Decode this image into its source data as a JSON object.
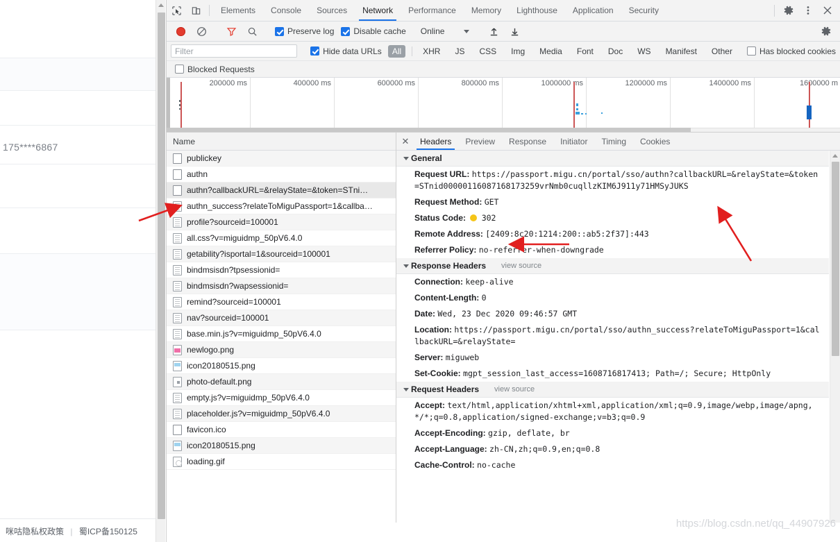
{
  "page": {
    "masked_phone": "175****6867",
    "footer": {
      "privacy_link": "咪咕隐私权政策",
      "separator": "|",
      "icp": "蜀ICP备150125"
    }
  },
  "devtools": {
    "main_tabs": [
      {
        "label": "Elements",
        "active": false
      },
      {
        "label": "Console",
        "active": false
      },
      {
        "label": "Sources",
        "active": false
      },
      {
        "label": "Network",
        "active": true
      },
      {
        "label": "Performance",
        "active": false
      },
      {
        "label": "Memory",
        "active": false
      },
      {
        "label": "Lighthouse",
        "active": false
      },
      {
        "label": "Application",
        "active": false
      },
      {
        "label": "Security",
        "active": false
      }
    ],
    "toolbar": {
      "record_title": "record-button",
      "clear_title": "clear-button",
      "filter_title": "filter-button",
      "search_title": "search-button",
      "preserve_log_label": "Preserve log",
      "preserve_log_checked": true,
      "disable_cache_label": "Disable cache",
      "disable_cache_checked": true,
      "throttle_value": "Online",
      "import_title": "import-har-button",
      "export_title": "export-har-button",
      "settings_title": "network-settings-button"
    },
    "filterbar": {
      "filter_placeholder": "Filter",
      "filter_value": "",
      "hide_data_urls_label": "Hide data URLs",
      "hide_data_urls_checked": true,
      "resource_types": [
        "All",
        "XHR",
        "JS",
        "CSS",
        "Img",
        "Media",
        "Font",
        "Doc",
        "WS",
        "Manifest",
        "Other"
      ],
      "selected_resource_type": "All",
      "has_blocked_cookies_label": "Has blocked cookies",
      "has_blocked_cookies_checked": false,
      "blocked_requests_label": "Blocked Requests",
      "blocked_requests_checked": false
    },
    "overview": {
      "ticks": [
        "200000 ms",
        "400000 ms",
        "600000 ms",
        "800000 ms",
        "1000000 ms",
        "1200000 ms",
        "1400000 ms",
        "1600000 m"
      ]
    },
    "requests": {
      "column_header": "Name",
      "rows": [
        {
          "name": "publickey",
          "icon": "blank-file-icon",
          "selected": false
        },
        {
          "name": "authn",
          "icon": "blank-file-icon",
          "selected": false
        },
        {
          "name": "authn?callbackURL=&relayState=&token=STni…",
          "icon": "blank-file-icon",
          "selected": true
        },
        {
          "name": "authn_success?relateToMiguPassport=1&callba…",
          "icon": "document-icon",
          "selected": false
        },
        {
          "name": "profile?sourceid=100001",
          "icon": "document-icon",
          "selected": false
        },
        {
          "name": "all.css?v=miguidmp_50pV6.4.0",
          "icon": "document-icon",
          "selected": false
        },
        {
          "name": "getability?isportal=1&sourceid=100001",
          "icon": "document-icon",
          "selected": false
        },
        {
          "name": "bindmsisdn?tpsessionid=",
          "icon": "document-icon",
          "selected": false
        },
        {
          "name": "bindmsisdn?wapsessionid=",
          "icon": "document-icon",
          "selected": false
        },
        {
          "name": "remind?sourceid=100001",
          "icon": "document-icon",
          "selected": false
        },
        {
          "name": "nav?sourceid=100001",
          "icon": "document-icon",
          "selected": false
        },
        {
          "name": "base.min.js?v=miguidmp_50pV6.4.0",
          "icon": "document-icon",
          "selected": false
        },
        {
          "name": "newlogo.png",
          "icon": "image-thumb-pink-icon",
          "selected": false
        },
        {
          "name": "icon20180515.png",
          "icon": "image-thumb-blue-icon",
          "selected": false
        },
        {
          "name": "photo-default.png",
          "icon": "image-thumb-dot-icon",
          "selected": false
        },
        {
          "name": "empty.js?v=miguidmp_50pV6.4.0",
          "icon": "document-icon",
          "selected": false
        },
        {
          "name": "placeholder.js?v=miguidmp_50pV6.4.0",
          "icon": "document-icon",
          "selected": false
        },
        {
          "name": "favicon.ico",
          "icon": "blank-file-icon",
          "selected": false
        },
        {
          "name": "icon20180515.png",
          "icon": "image-thumb-blue-icon",
          "selected": false
        },
        {
          "name": "loading.gif",
          "icon": "gif-icon",
          "selected": false
        }
      ]
    },
    "detail": {
      "tabs": [
        {
          "label": "Headers",
          "active": true
        },
        {
          "label": "Preview",
          "active": false
        },
        {
          "label": "Response",
          "active": false
        },
        {
          "label": "Initiator",
          "active": false
        },
        {
          "label": "Timing",
          "active": false
        },
        {
          "label": "Cookies",
          "active": false
        }
      ],
      "general": {
        "title": "General",
        "entries": [
          {
            "key": "Request URL:",
            "value": "https://passport.migu.cn/portal/sso/authn?callbackURL=&relayState=&token=STnid00000116087168173259vrNmb0cuqllzKIM6J911y71HMSyJUKS"
          },
          {
            "key": "Request Method:",
            "value": "GET"
          },
          {
            "key": "Status Code:",
            "value": "302",
            "status_dot": true
          },
          {
            "key": "Remote Address:",
            "value": "[2409:8c20:1214:200::ab5:2f37]:443"
          },
          {
            "key": "Referrer Policy:",
            "value": "no-referrer-when-downgrade"
          }
        ]
      },
      "response_headers": {
        "title": "Response Headers",
        "view_source": "view source",
        "entries": [
          {
            "key": "Connection:",
            "value": "keep-alive"
          },
          {
            "key": "Content-Length:",
            "value": "0"
          },
          {
            "key": "Date:",
            "value": "Wed, 23 Dec 2020 09:46:57 GMT"
          },
          {
            "key": "Location:",
            "value": "https://passport.migu.cn/portal/sso/authn_success?relateToMiguPassport=1&callbackURL=&relayState="
          },
          {
            "key": "Server:",
            "value": "miguweb"
          },
          {
            "key": "Set-Cookie:",
            "value": "mgpt_session_last_access=1608716817413; Path=/; Secure; HttpOnly"
          }
        ]
      },
      "request_headers": {
        "title": "Request Headers",
        "view_source": "view source",
        "entries": [
          {
            "key": "Accept:",
            "value": "text/html,application/xhtml+xml,application/xml;q=0.9,image/webp,image/apng,*/*;q=0.8,application/signed-exchange;v=b3;q=0.9"
          },
          {
            "key": "Accept-Encoding:",
            "value": "gzip, deflate, br"
          },
          {
            "key": "Accept-Language:",
            "value": "zh-CN,zh;q=0.9,en;q=0.8"
          },
          {
            "key": "Cache-Control:",
            "value": "no-cache"
          }
        ]
      }
    }
  },
  "watermark": "https://blog.csdn.net/qq_44907926",
  "colors": {
    "accent_blue": "#1a73e8",
    "record_red": "#e33b2e",
    "status_302_dot": "#f5c518",
    "annotation_red": "#e11f1f",
    "toolbar_bg": "#f3f3f3"
  }
}
